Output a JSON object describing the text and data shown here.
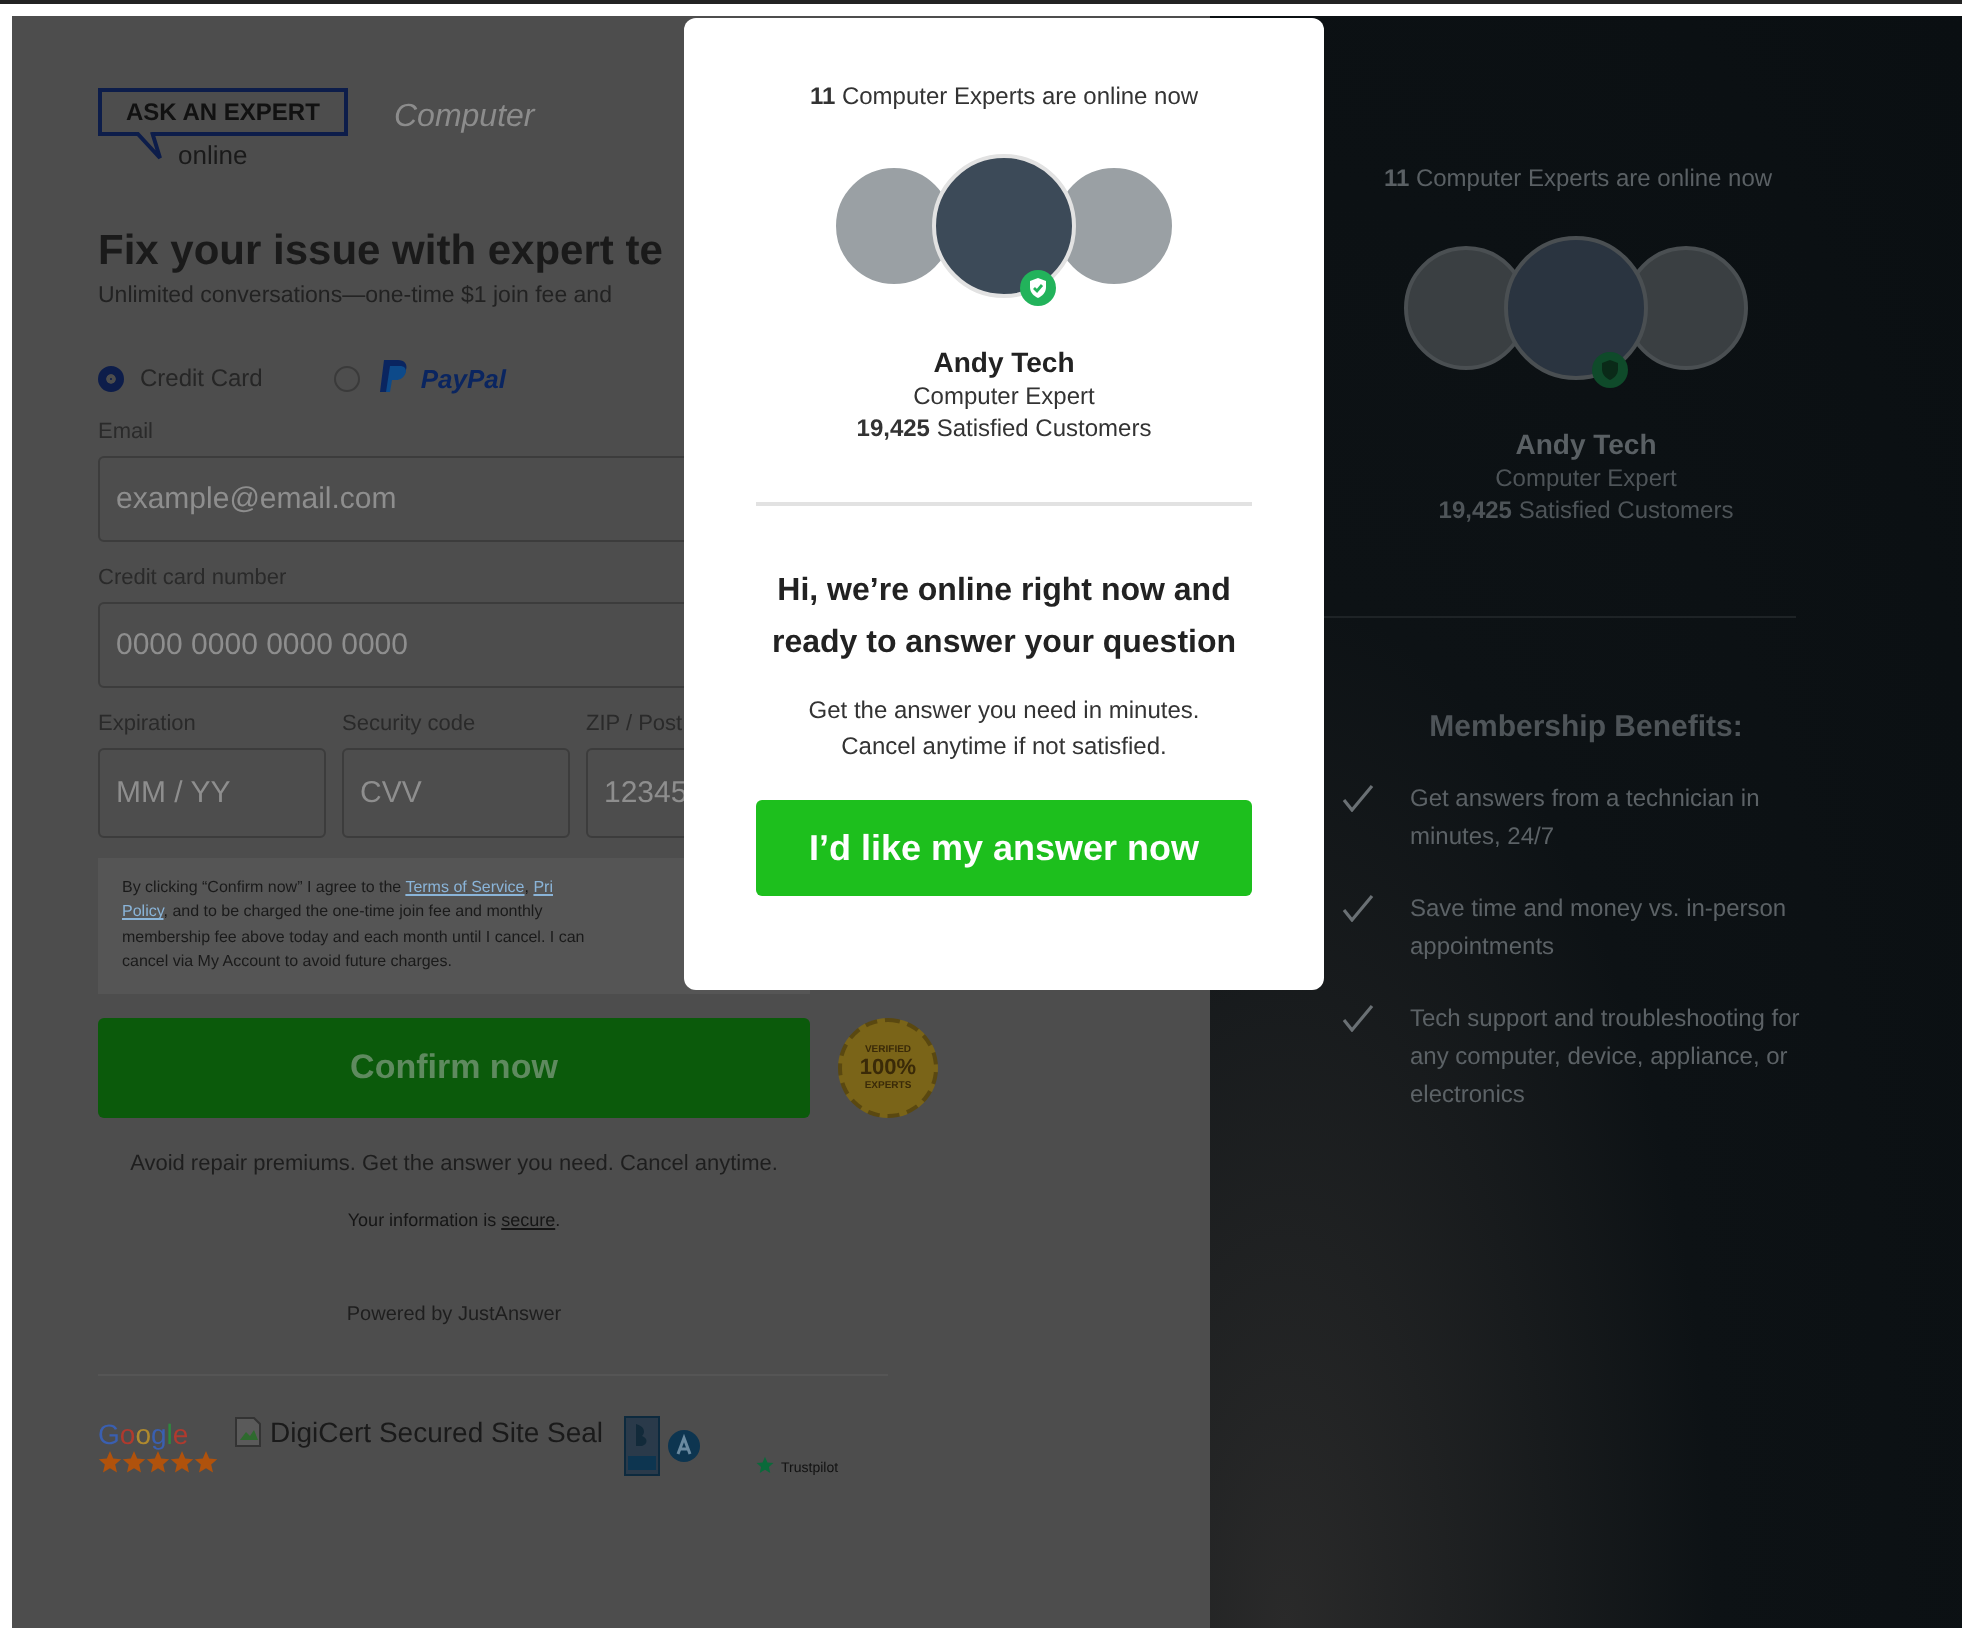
{
  "logo": {
    "title": "ASK AN EXPERT",
    "subtitle": "online",
    "category": "Computer"
  },
  "heading": "Fix your issue with expert te",
  "subheading": "Unlimited conversations—one-time $1 join fee and",
  "payment_methods": [
    {
      "kind": "card",
      "label": "Credit Card",
      "selected": true
    },
    {
      "kind": "paypal",
      "label": "PayPal",
      "selected": false
    }
  ],
  "email": {
    "label": "Email",
    "placeholder": "example@email.com"
  },
  "card_number": {
    "label": "Credit card number",
    "placeholder": "0000 0000 0000 0000"
  },
  "small_fields": [
    {
      "label": "Expiration",
      "placeholder": "MM / YY"
    },
    {
      "label": "Security code",
      "placeholder": "CVV"
    },
    {
      "label": "ZIP / Post",
      "placeholder": "12345"
    }
  ],
  "terms": [
    {
      "kind": "text",
      "text": "By clicking “Confirm now” I agree to the "
    },
    {
      "kind": "link",
      "text": "Terms of Service"
    },
    {
      "kind": "text",
      "text": ", "
    },
    {
      "kind": "link",
      "text": "Pri"
    },
    {
      "kind": "break"
    },
    {
      "kind": "link",
      "text": "Policy"
    },
    {
      "kind": "text",
      "text": ", and to be charged the one-time join fee and monthly"
    },
    {
      "kind": "break"
    },
    {
      "kind": "text",
      "text": "membership fee above today and each month until I cancel. I can"
    },
    {
      "kind": "break"
    },
    {
      "kind": "text",
      "text": "cancel via My Account to avoid future charges."
    }
  ],
  "confirm_button": "Confirm now",
  "verified_badge": {
    "top": "VERIFIED",
    "value": "100%",
    "bottom": "EXPERTS"
  },
  "reassurance": "Avoid repair premiums. Get the answer you need. Cancel anytime.",
  "secure_note": [
    {
      "kind": "text",
      "text": "Your information is "
    },
    {
      "kind": "link",
      "text": "secure"
    },
    {
      "kind": "text",
      "text": "."
    }
  ],
  "powered_by": "Powered by JustAnswer",
  "trust": {
    "google": "Google",
    "stars": 5,
    "digicert": "DigiCert Secured Site Seal",
    "trustpilot": "Trustpilot"
  },
  "sidebar": {
    "online": "**11** Computer Experts are online now",
    "name": "Andy Tech",
    "role": "Computer Expert",
    "customers": "**19,425** Satisfied Customers",
    "benefits_title": "Membership Benefits:",
    "benefits": [
      "Get answers from a technician in minutes, 24/7",
      "Save time and money vs. in-person appointments",
      "Tech support and troubleshooting for any computer, device, appliance, or electronics"
    ]
  },
  "modal": {
    "online": "**11** Computer Experts are online now",
    "name": "Andy Tech",
    "role": "Computer Expert",
    "customers": "**19,425** Satisfied Customers",
    "headline": "Hi, we’re online right now and ready to answer your question",
    "body": [
      "Get the answer you need in minutes.",
      "Cancel anytime if not satisfied."
    ],
    "button": "I’d like my answer now"
  }
}
